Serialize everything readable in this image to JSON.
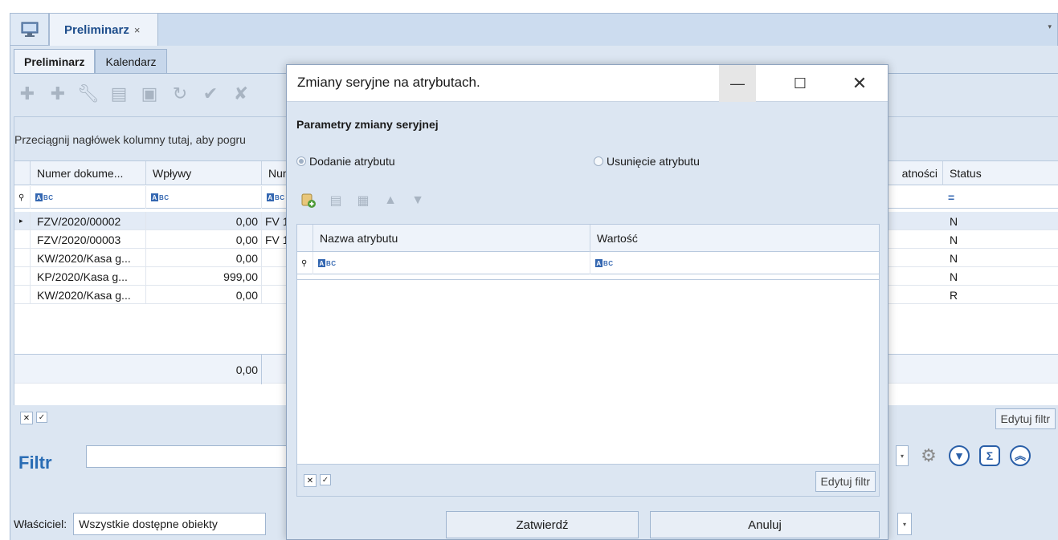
{
  "doc_tabs": {
    "active_tab_label": "Preliminarz",
    "close_glyph": "×",
    "dropdown_glyph": "▾"
  },
  "sub_tabs": [
    "Preliminarz",
    "Kalendarz"
  ],
  "toolbar_icons": [
    "plus-icon",
    "plus-green-icon",
    "wrench-icon",
    "document-icon",
    "document-edit-icon",
    "refresh-icon",
    "check-icon",
    "cancel-check-icon"
  ],
  "grid": {
    "group_panel_text": "Przeciągnij nagłówek kolumny tutaj, aby pogru",
    "columns": [
      "Numer dokume...",
      "Wpływy",
      "Num",
      "atności",
      "Status"
    ],
    "rows": [
      {
        "numer": "FZV/2020/00002",
        "wplywy": "0,00",
        "num": "FV 1",
        "status": "N"
      },
      {
        "numer": "FZV/2020/00003",
        "wplywy": "0,00",
        "num": "FV 1",
        "status": "N"
      },
      {
        "numer": "KW/2020/Kasa g...",
        "wplywy": "0,00",
        "num": "",
        "status": "N"
      },
      {
        "numer": "KP/2020/Kasa g...",
        "wplywy": "999,00",
        "num": "",
        "status": "N"
      },
      {
        "numer": "KW/2020/Kasa g...",
        "wplywy": "0,00",
        "num": "",
        "status": "R"
      }
    ],
    "sum_wplywy": "0,00",
    "status_filter_symbol": "="
  },
  "grid_footer": {
    "edit_filter_label": "Edytuj filtr"
  },
  "filter_section": {
    "title": "Filtr",
    "value": ""
  },
  "owner": {
    "label": "Właściciel:",
    "value": "Wszystkie dostępne obiekty"
  },
  "modal": {
    "title": "Zmiany seryjne na atrybutach.",
    "section_title": "Parametry zmiany seryjnej",
    "radio_add": "Dodanie atrybutu",
    "radio_remove": "Usunięcie atrybutu",
    "columns": [
      "Nazwa atrybutu",
      "Wartość"
    ],
    "edit_filter_label": "Edytuj filtr",
    "confirm_label": "Zatwierdź",
    "cancel_label": "Anuluj"
  },
  "colors": {
    "accent_blue": "#2a6db5",
    "panel_bg": "#dce6f2",
    "header_bg": "#eef3fa"
  }
}
